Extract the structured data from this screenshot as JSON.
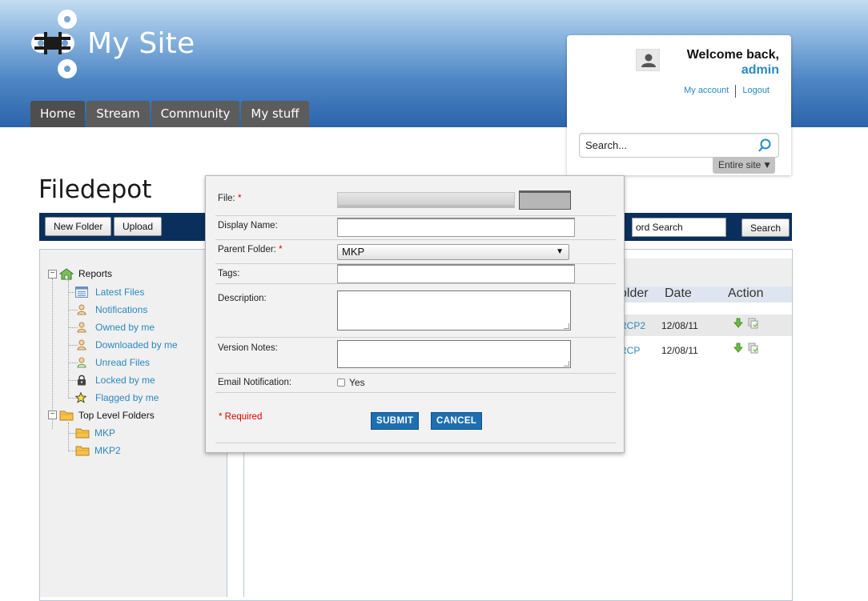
{
  "site": {
    "name": "My Site",
    "nav": [
      "Home",
      "Stream",
      "Community",
      "My stuff"
    ]
  },
  "user": {
    "welcome": "Welcome back,",
    "username": "admin",
    "my_account": "My account",
    "logout": "Logout",
    "search_placeholder": "Search...",
    "search_scope": "Entire site"
  },
  "page": {
    "title": "Filedepot",
    "toolbar": {
      "new_folder": "New Folder",
      "upload": "Upload",
      "keyword_value": "ord Search",
      "search_button": "Search"
    }
  },
  "tree": {
    "reports_label": "Reports",
    "reports": [
      "Latest Files",
      "Notifications",
      "Owned by me",
      "Downloaded by me",
      "Unread Files",
      "Locked by me",
      "Flagged by me"
    ],
    "top_label": "Top Level Folders",
    "folders": [
      "MKP",
      "MKP2"
    ]
  },
  "file_list": {
    "columns": {
      "folder": "older",
      "date": "Date",
      "action": "Action"
    },
    "rows": [
      {
        "folder": "RCP2",
        "date": "12/08/11"
      },
      {
        "folder": "RCP",
        "date": "12/08/11"
      }
    ]
  },
  "modal": {
    "file_label": "File:",
    "display_name_label": "Display Name:",
    "parent_folder_label": "Parent Folder:",
    "parent_folder_value": "MKP",
    "tags_label": "Tags:",
    "description_label": "Description:",
    "version_notes_label": "Version Notes:",
    "email_label": "Email Notification:",
    "email_yes": "Yes",
    "required_mark": "*",
    "required_note": "* Required",
    "submit": "SUBMIT",
    "cancel": "CANCEL"
  },
  "colors": {
    "link": "#2a88c0",
    "toolbar_bg": "#0a2f5c",
    "button_blue": "#1e6fb2",
    "required_red": "#dd0000",
    "nav_tab": "#5c5c5c"
  }
}
